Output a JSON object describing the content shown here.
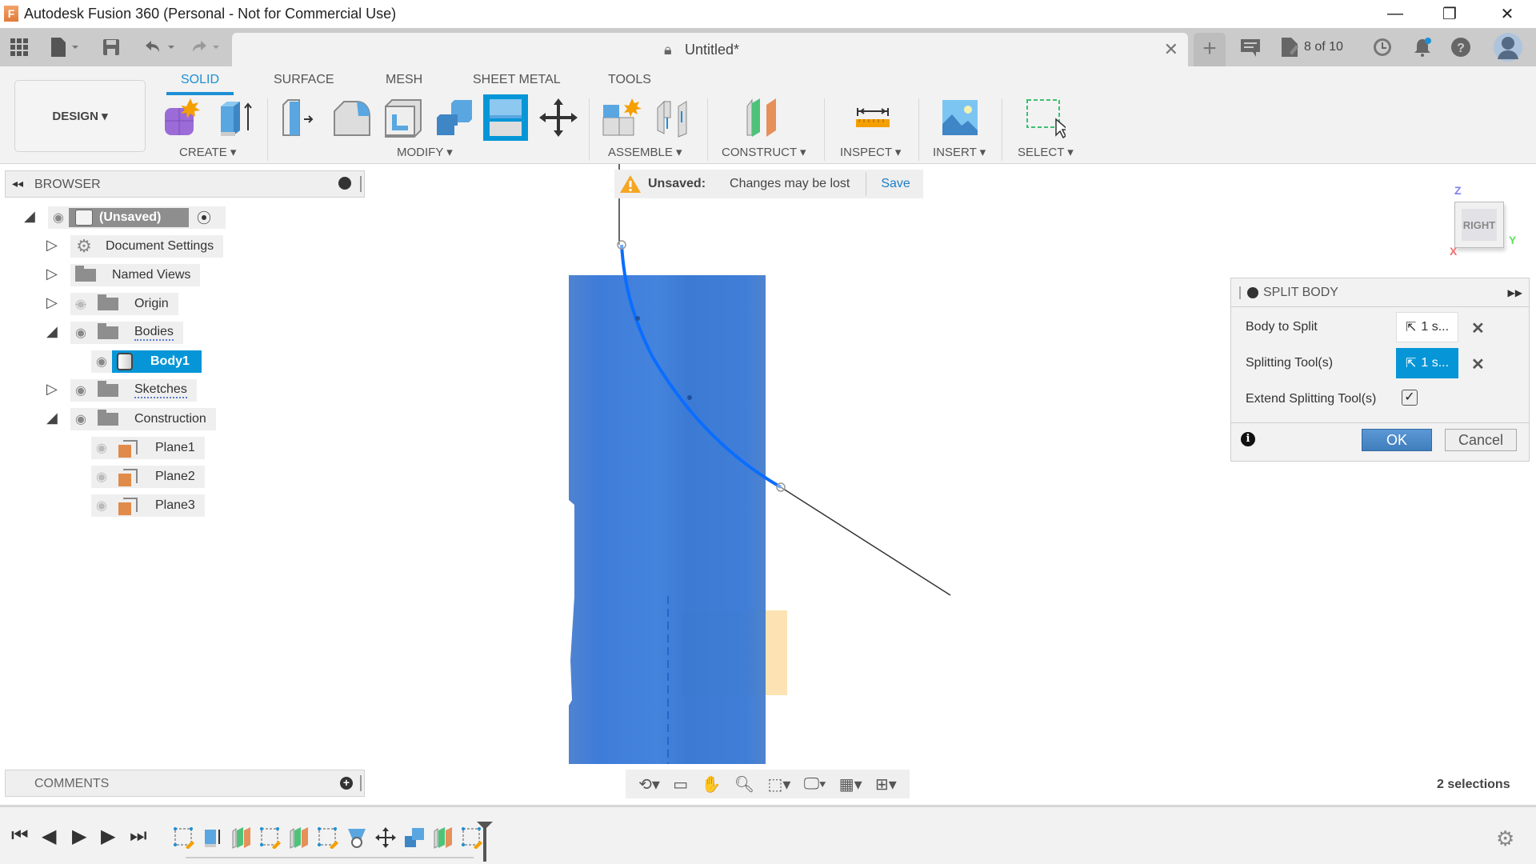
{
  "app": {
    "title": "Autodesk Fusion 360 (Personal - Not for Commercial Use)",
    "logo_letter": "F"
  },
  "window_controls": {
    "minimize": "—",
    "restore": "❐",
    "close": "✕"
  },
  "topbar": {
    "doc_title": "Untitled*",
    "job_status": "8 of 10",
    "icons": [
      "apps-grid-icon",
      "file-icon",
      "save-icon",
      "undo-icon",
      "redo-icon",
      "new-tab-icon",
      "comments-icon",
      "job-status-icon",
      "history-clock-icon",
      "notifications-bell-icon",
      "help-icon",
      "user-avatar-icon"
    ]
  },
  "ribbon": {
    "workspace": "DESIGN ▾",
    "tabs": [
      {
        "label": "SOLID",
        "active": true
      },
      {
        "label": "SURFACE",
        "active": false
      },
      {
        "label": "MESH",
        "active": false
      },
      {
        "label": "SHEET METAL",
        "active": false
      },
      {
        "label": "TOOLS",
        "active": false
      }
    ],
    "groups": [
      {
        "label": "CREATE ▾",
        "tools": [
          "new-component",
          "extrude"
        ]
      },
      {
        "label": "MODIFY ▾",
        "tools": [
          "press-pull",
          "fillet",
          "shell",
          "combine",
          "split-body",
          "move-copy"
        ]
      },
      {
        "label": "ASSEMBLE ▾",
        "tools": [
          "new-component",
          "joint"
        ]
      },
      {
        "label": "CONSTRUCT ▾",
        "tools": [
          "offset-plane"
        ]
      },
      {
        "label": "INSPECT ▾",
        "tools": [
          "measure"
        ]
      },
      {
        "label": "INSERT ▾",
        "tools": [
          "insert-image"
        ]
      },
      {
        "label": "SELECT ▾",
        "tools": [
          "window-select"
        ]
      }
    ]
  },
  "browser": {
    "title": "BROWSER",
    "root": "(Unsaved)",
    "items": [
      {
        "label": "Document Settings",
        "icon": "gear"
      },
      {
        "label": "Named Views",
        "icon": "folder"
      },
      {
        "label": "Origin",
        "icon": "folder",
        "hidden": true
      },
      {
        "label": "Bodies",
        "icon": "folder"
      },
      {
        "label": "Body1",
        "icon": "body",
        "selected": true
      },
      {
        "label": "Sketches",
        "icon": "folder"
      },
      {
        "label": "Construction",
        "icon": "folder"
      },
      {
        "label": "Plane1",
        "icon": "plane",
        "hidden": true
      },
      {
        "label": "Plane2",
        "icon": "plane",
        "hidden": true
      },
      {
        "label": "Plane3",
        "icon": "plane",
        "hidden": true
      }
    ]
  },
  "unsaved_banner": {
    "label": "Unsaved:",
    "message": "Changes may be lost",
    "action": "Save"
  },
  "viewcube": {
    "face": "RIGHT",
    "axis_z": "Z",
    "axis_y": "Y",
    "axis_x": "X"
  },
  "split_body": {
    "title": "SPLIT BODY",
    "body_to_split_label": "Body to Split",
    "body_to_split_value": "1 s...",
    "splitting_tools_label": "Splitting Tool(s)",
    "splitting_tools_value": "1 s...",
    "extend_label": "Extend Splitting Tool(s)",
    "extend_checked": true,
    "ok": "OK",
    "cancel": "Cancel",
    "clear": "✕"
  },
  "comments": {
    "title": "COMMENTS"
  },
  "status": {
    "selections": "2 selections"
  },
  "colors": {
    "accent": "#0696d7",
    "body": "#3a7bd5",
    "curve": "#0a6dff",
    "ok_button": "#4a88c8",
    "warning": "#f5a623"
  }
}
